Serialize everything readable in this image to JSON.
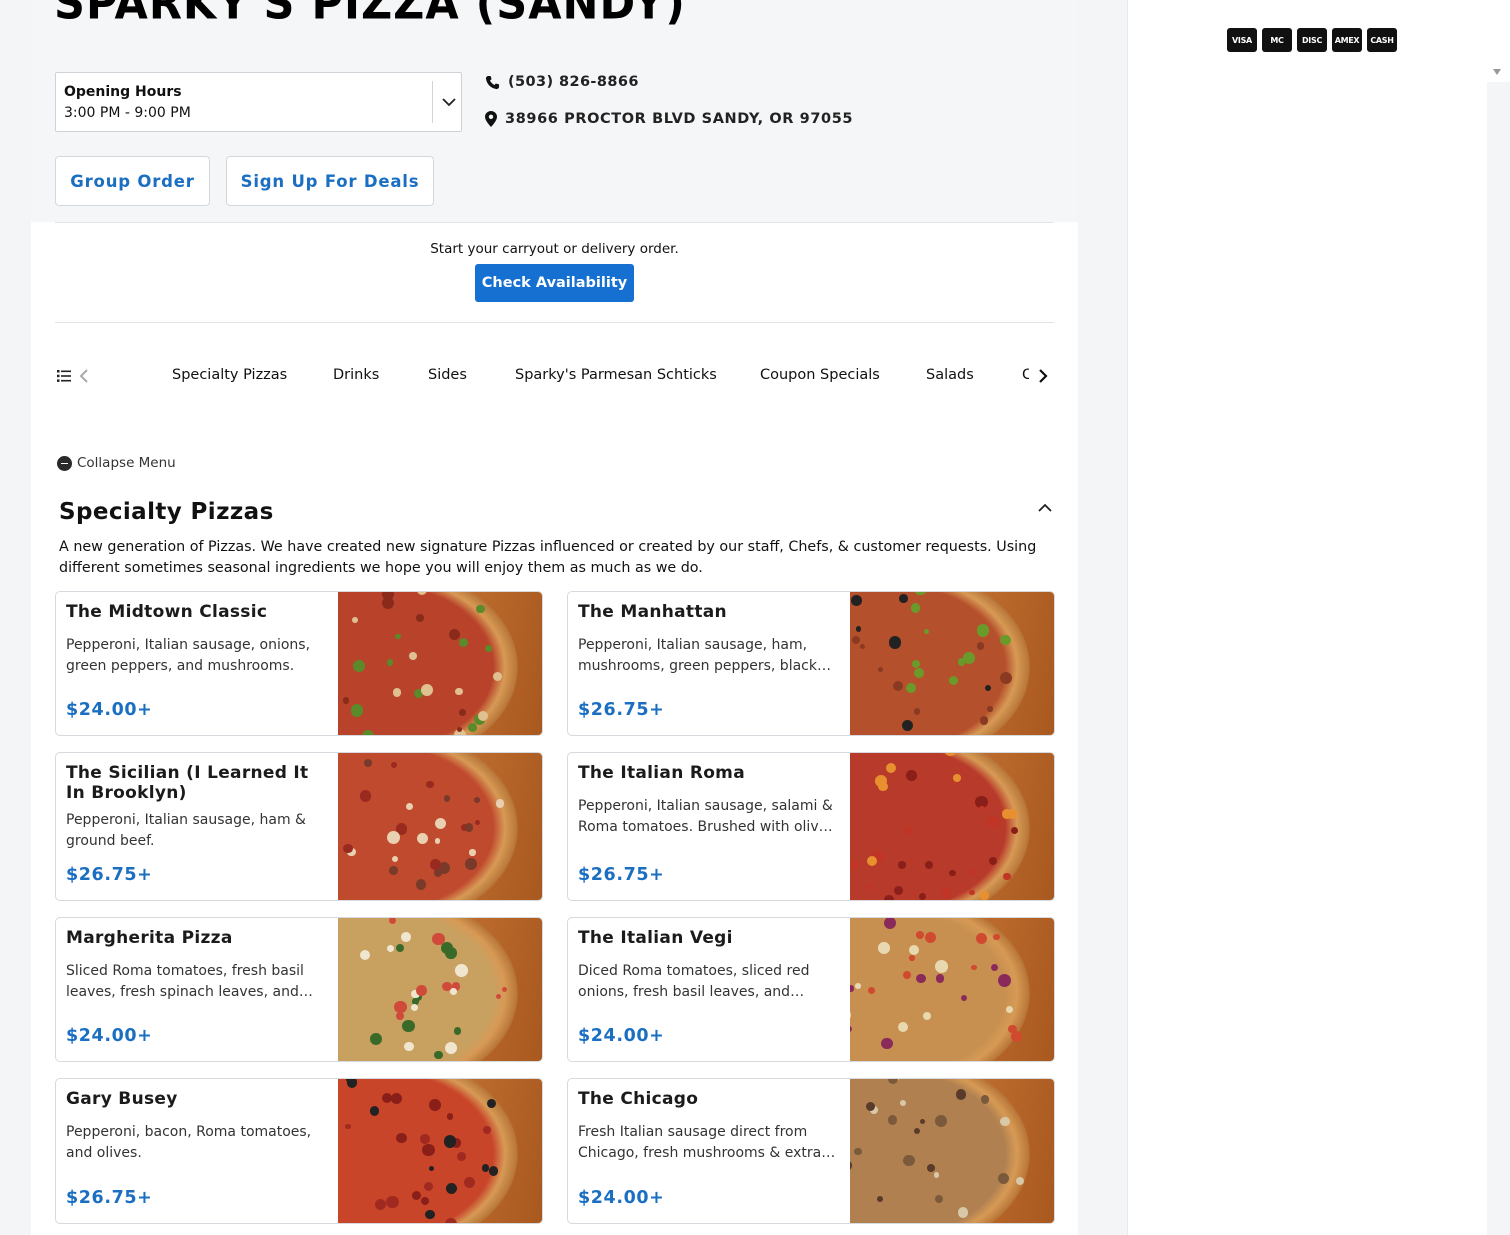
{
  "restaurant": {
    "name": "SPARKY'S PIZZA (SANDY)",
    "hours_label": "Opening Hours",
    "hours_value": "3:00 PM - 9:00 PM",
    "phone": "(503) 826-8866",
    "address": "38966 PROCTOR BLVD SANDY, OR 97055"
  },
  "actions": {
    "group_order": "Group Order",
    "sign_up": "Sign Up For Deals",
    "start_text": "Start your carryout or delivery order.",
    "check_availability": "Check Availability"
  },
  "categories": [
    "Specialty Pizzas",
    "Drinks",
    "Sides",
    "Sparky's Parmesan Schticks",
    "Coupon Specials",
    "Salads",
    "C"
  ],
  "menu": {
    "collapse_label": "Collapse Menu",
    "section_title": "Specialty Pizzas",
    "section_desc": "A new generation of Pizzas. We have created new signature Pizzas influenced or created by our staff, Chefs, & customer requests. Using different sometimes seasonal ingredients we hope you will enjoy them as much as we do.",
    "items": [
      {
        "name": "The Midtown Classic",
        "desc": "Pepperoni, Italian sausage, onions, green peppers, and mushrooms.",
        "price": "$24.00+"
      },
      {
        "name": "The Manhattan",
        "desc": "Pepperoni, Italian sausage, ham, mushrooms, green peppers, black olives, and onions.",
        "price": "$26.75+"
      },
      {
        "name": "The Sicilian (I Learned It In Brooklyn)",
        "desc": "Pepperoni, Italian sausage, ham & ground beef.",
        "price": "$26.75+"
      },
      {
        "name": "The Italian Roma",
        "desc": "Pepperoni, Italian sausage, salami & Roma tomatoes. Brushed with olive oil.",
        "price": "$26.75+"
      },
      {
        "name": "Margherita Pizza",
        "desc": "Sliced Roma tomatoes, fresh basil leaves, fresh spinach leaves, and mozzarella.",
        "price": "$24.00+"
      },
      {
        "name": "The Italian Vegi",
        "desc": "Diced Roma tomatoes, sliced red onions, fresh basil leaves, and mushrooms.",
        "price": "$24.00+"
      },
      {
        "name": "Gary Busey",
        "desc": "Pepperoni, bacon, Roma tomatoes, and olives.",
        "price": "$26.75+"
      },
      {
        "name": "The Chicago",
        "desc": "Fresh Italian sausage direct from Chicago, fresh mushrooms & extra cheese.",
        "price": "$24.00+"
      }
    ]
  },
  "payment_methods": [
    "VISA",
    "MC",
    "DISC",
    "AMEX",
    "CASH"
  ],
  "colors": {
    "accent": "#1b6fc2",
    "button": "#1670d1"
  }
}
